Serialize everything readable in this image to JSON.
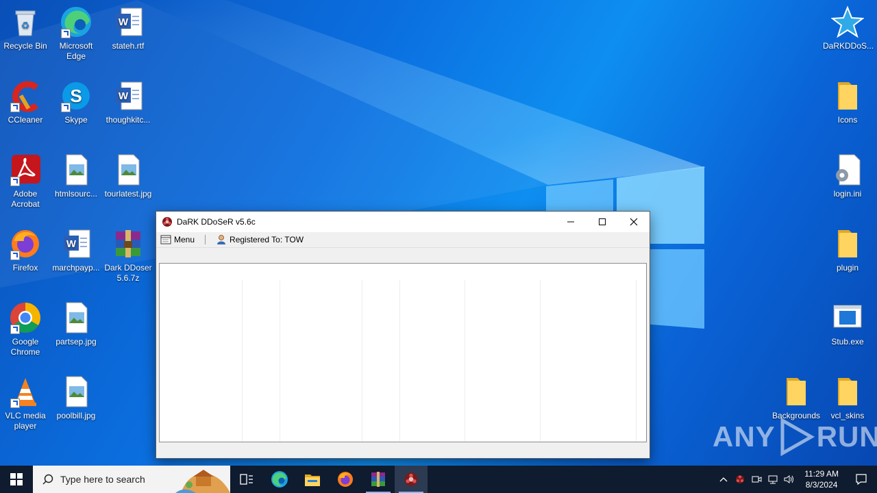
{
  "desktop": {
    "icons": [
      {
        "label": "Recycle Bin",
        "icon": "recycle-bin-icon"
      },
      {
        "label": "Microsoft Edge",
        "icon": "edge-icon"
      },
      {
        "label": "stateh.rtf",
        "icon": "word-doc-icon"
      },
      {
        "label": "CCleaner",
        "icon": "ccleaner-icon"
      },
      {
        "label": "Skype",
        "icon": "skype-icon"
      },
      {
        "label": "thoughkitc...",
        "icon": "word-doc-icon"
      },
      {
        "label": "Adobe Acrobat",
        "icon": "acrobat-icon"
      },
      {
        "label": "htmlsourc...",
        "icon": "image-file-icon"
      },
      {
        "label": "tourlatest.jpg",
        "icon": "image-file-icon"
      },
      {
        "label": "Firefox",
        "icon": "firefox-icon"
      },
      {
        "label": "marchpayp...",
        "icon": "word-doc-icon"
      },
      {
        "label": "Dark DDoser 5.6.7z",
        "icon": "winrar-archive-icon"
      },
      {
        "label": "Google Chrome",
        "icon": "chrome-icon"
      },
      {
        "label": "partsep.jpg",
        "icon": "image-file-icon"
      },
      {
        "label": "VLC media player",
        "icon": "vlc-icon"
      },
      {
        "label": "poolbill.jpg",
        "icon": "image-file-icon"
      },
      {
        "label": "DaRKDDoS...",
        "icon": "star-icon"
      },
      {
        "label": "Icons",
        "icon": "folder-icon"
      },
      {
        "label": "login.ini",
        "icon": "settings-file-icon"
      },
      {
        "label": "plugin",
        "icon": "folder-icon"
      },
      {
        "label": "Stub.exe",
        "icon": "exe-window-icon"
      },
      {
        "label": "Backgrounds",
        "icon": "folder-icon"
      },
      {
        "label": "vcl_skins",
        "icon": "folder-icon"
      }
    ]
  },
  "window": {
    "title": "DaRK DDoSeR v5.6c",
    "menu_label": "Menu",
    "registered_label": "Registered To: TOW"
  },
  "taskbar": {
    "search_placeholder": "Type here to search",
    "time": "11:29 AM",
    "date": "8/3/2024"
  },
  "watermark": {
    "left": "ANY",
    "right": "RUN"
  },
  "colors": {
    "desktop": "#0b6fe0",
    "taskbar": "#0f1b2e",
    "accent": "#0078d7"
  }
}
